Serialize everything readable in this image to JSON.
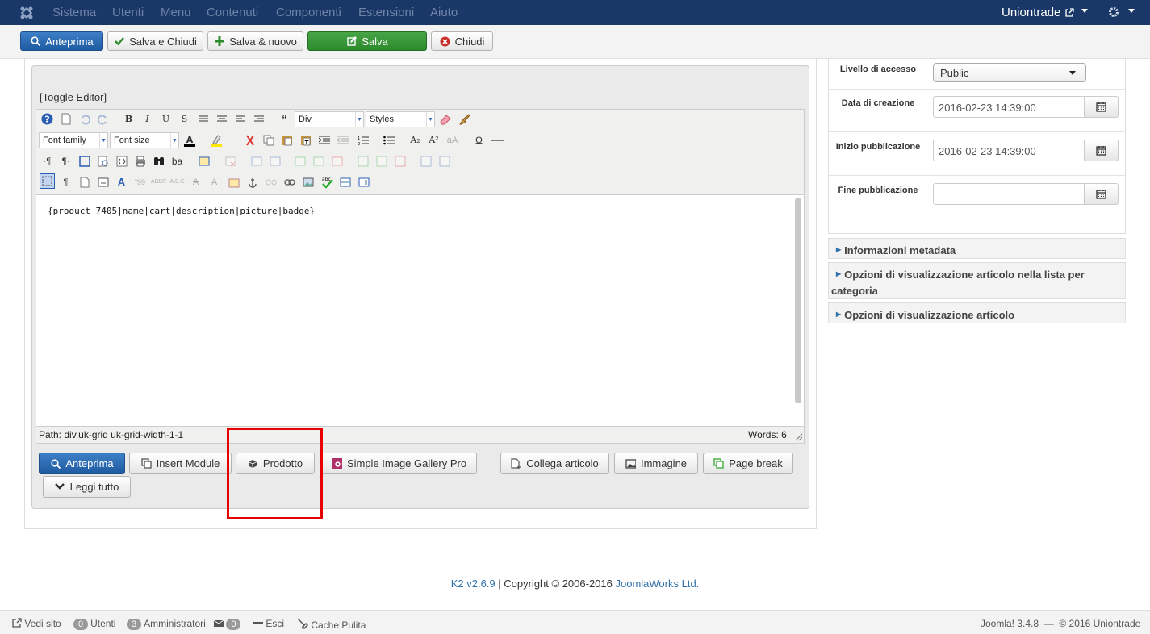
{
  "nav": {
    "menu": [
      "Sistema",
      "Utenti",
      "Menu",
      "Contenuti",
      "Componenti",
      "Estensioni",
      "Aiuto"
    ],
    "site_name": "Uniontrade"
  },
  "toolbar": {
    "preview_label": "Anteprima",
    "save_close_label": "Salva e Chiudi",
    "save_new_label": "Salva & nuovo",
    "save_label": "Salva",
    "close_label": "Chiudi"
  },
  "editor": {
    "toggle_label": "[Toggle Editor]",
    "format_select": "Div",
    "styles_select": "Styles",
    "font_family": "Font family",
    "font_size": "Font size",
    "content": "{product 7405|name|cart|description|picture|badge}",
    "path_label": "Path:",
    "path_value": "div.uk-grid uk-grid-width-1-1",
    "words": "Words: 6"
  },
  "editor_buttons": {
    "preview": "Anteprima",
    "insert_module": "Insert Module",
    "product": "Prodotto",
    "gallery": "Simple Image Gallery Pro",
    "link_article": "Collega articolo",
    "image": "Immagine",
    "page_break": "Page break",
    "read_more": "Leggi tutto"
  },
  "sidebar": {
    "access_label": "Livello di accesso",
    "access_value": "Public",
    "created_label": "Data di creazione",
    "created_value": "2016-02-23 14:39:00",
    "publish_up_label": "Inizio pubblicazione",
    "publish_up_value": "2016-02-23 14:39:00",
    "publish_down_label": "Fine pubblicazione",
    "publish_down_value": "",
    "accordions": [
      "Informazioni metadata",
      "Opzioni di visualizzazione articolo nella lista per categoria",
      "Opzioni di visualizzazione articolo"
    ]
  },
  "footer": {
    "k2_version": "K2 v2.6.9",
    "copyright": " | Copyright © 2006-2016 ",
    "joomlaworks": "JoomlaWorks Ltd."
  },
  "statusbar": {
    "view_site": "Vedi sito",
    "users_count": "0",
    "users_label": "Utenti",
    "admins_count": "3",
    "admins_label": "Amministratori",
    "messages_count": "0",
    "logout_label": "Esci",
    "clean_cache": "Cache Pulita",
    "version": "Joomla! 3.4.8  —  © 2016 Uniontrade"
  },
  "colors": {
    "nav_bg": "#1a3867",
    "primary_blue": "#2160a8",
    "save_green": "#3e983e",
    "highlight_red": "#e60000"
  }
}
